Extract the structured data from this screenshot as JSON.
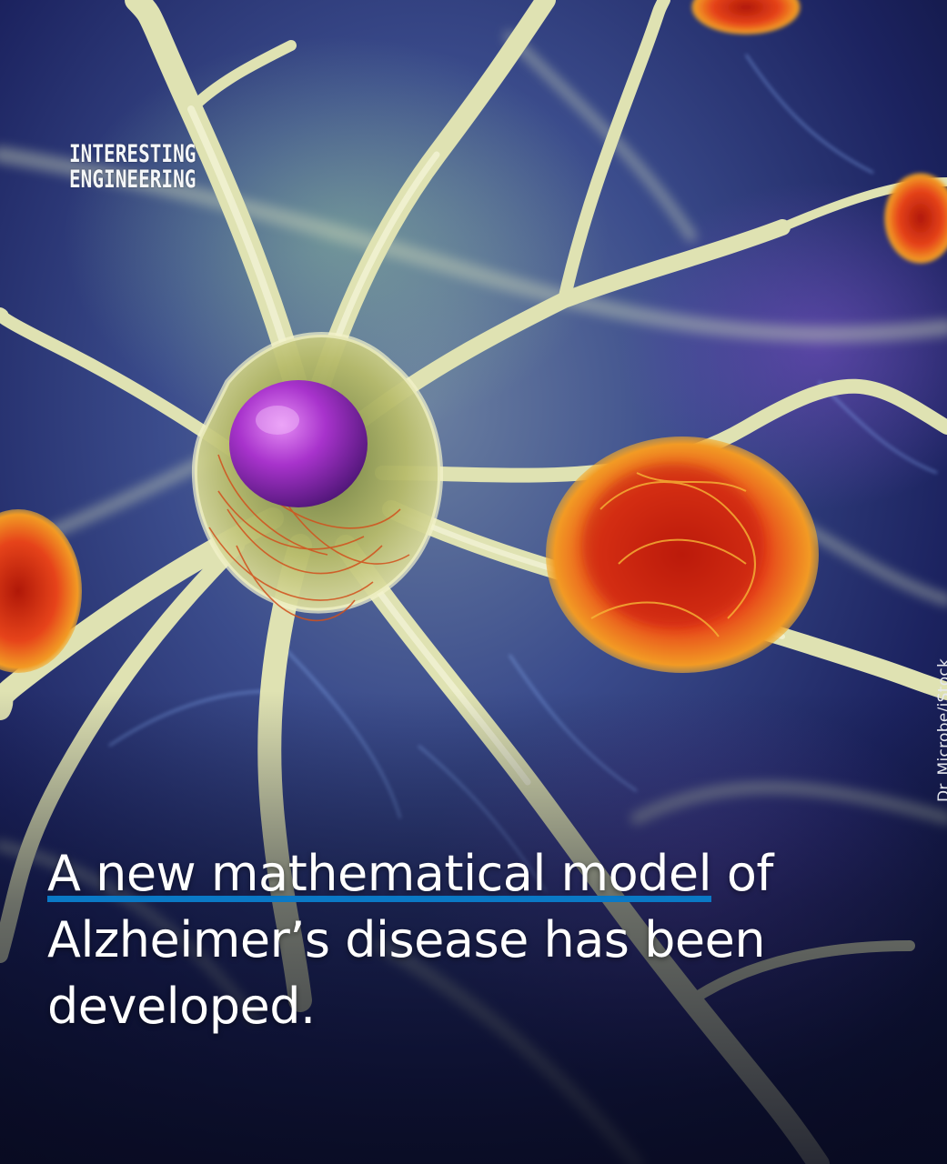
{
  "brand": {
    "logo_line1": "INTERESTING",
    "logo_line2": "ENGINEERING"
  },
  "image": {
    "subject": "neuron-with-amyloid-plaques-illustration",
    "credit": "Dr_Microbe/iStock"
  },
  "headline": {
    "highlighted": "A new mathematical model",
    "rest_line1": " of",
    "rest": "Alzheimer’s disease has been developed.",
    "highlight_color": "#0a79c6"
  },
  "colors": {
    "background": "#1a2060",
    "neuron": "#d9dca0",
    "nucleus": "#a030c8",
    "plaque": "#e8501a",
    "text": "#ffffff"
  }
}
